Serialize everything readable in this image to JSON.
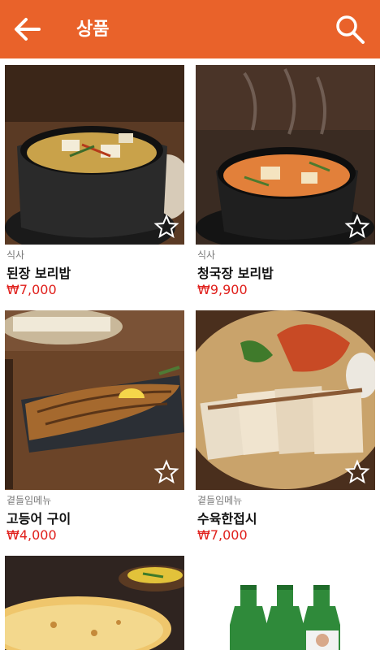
{
  "appbar": {
    "title": "상품",
    "bg_color": "#e9622a",
    "back_icon": "arrow-left-icon",
    "search_icon": "search-icon"
  },
  "products": [
    {
      "category": "식사",
      "name": "된장 보리밥",
      "price": "₩7,000",
      "image": "doenjang-stew-photo"
    },
    {
      "category": "식사",
      "name": "청국장 보리밥",
      "price": "₩9,900",
      "image": "cheonggukjang-stew-photo"
    },
    {
      "category": "곁들임메뉴",
      "name": "고등어 구이",
      "price": "₩4,000",
      "image": "grilled-mackerel-photo"
    },
    {
      "category": "곁들임메뉴",
      "name": "수육한접시",
      "price": "₩7,000",
      "image": "boiled-pork-photo"
    },
    {
      "category": "",
      "name": "",
      "price": "",
      "image": "pancake-photo"
    },
    {
      "category": "",
      "name": "",
      "price": "",
      "image": "soju-bottles-photo"
    }
  ],
  "accent_price_color": "#e0201c"
}
